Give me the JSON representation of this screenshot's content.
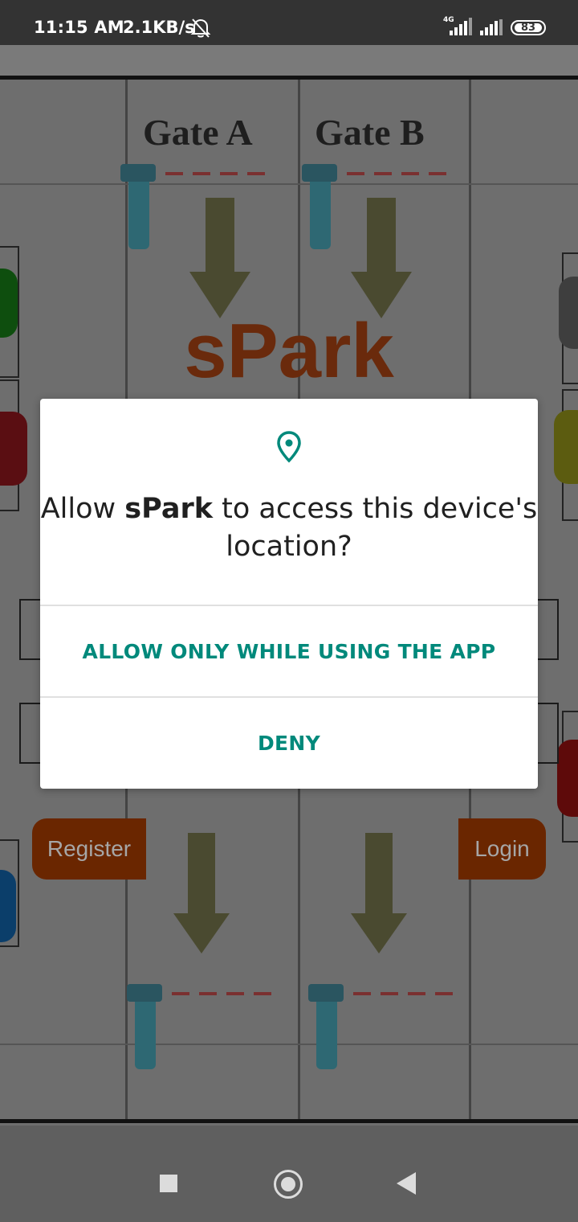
{
  "status_bar": {
    "time": "11:15 AM",
    "network_speed": "2.1KB/s",
    "network_type": "4G",
    "battery": "83"
  },
  "app": {
    "title": "sPark",
    "gate_a": "Gate A",
    "gate_b": "Gate B",
    "register_label": "Register",
    "login_label": "Login"
  },
  "dialog": {
    "question_prefix": "Allow ",
    "app_name": "sPark",
    "question_suffix": " to access this device's location?",
    "allow_label": "ALLOW ONLY WHILE USING THE APP",
    "deny_label": "DENY"
  },
  "colors": {
    "accent": "#00897b",
    "brand": "#6a2a0c"
  }
}
